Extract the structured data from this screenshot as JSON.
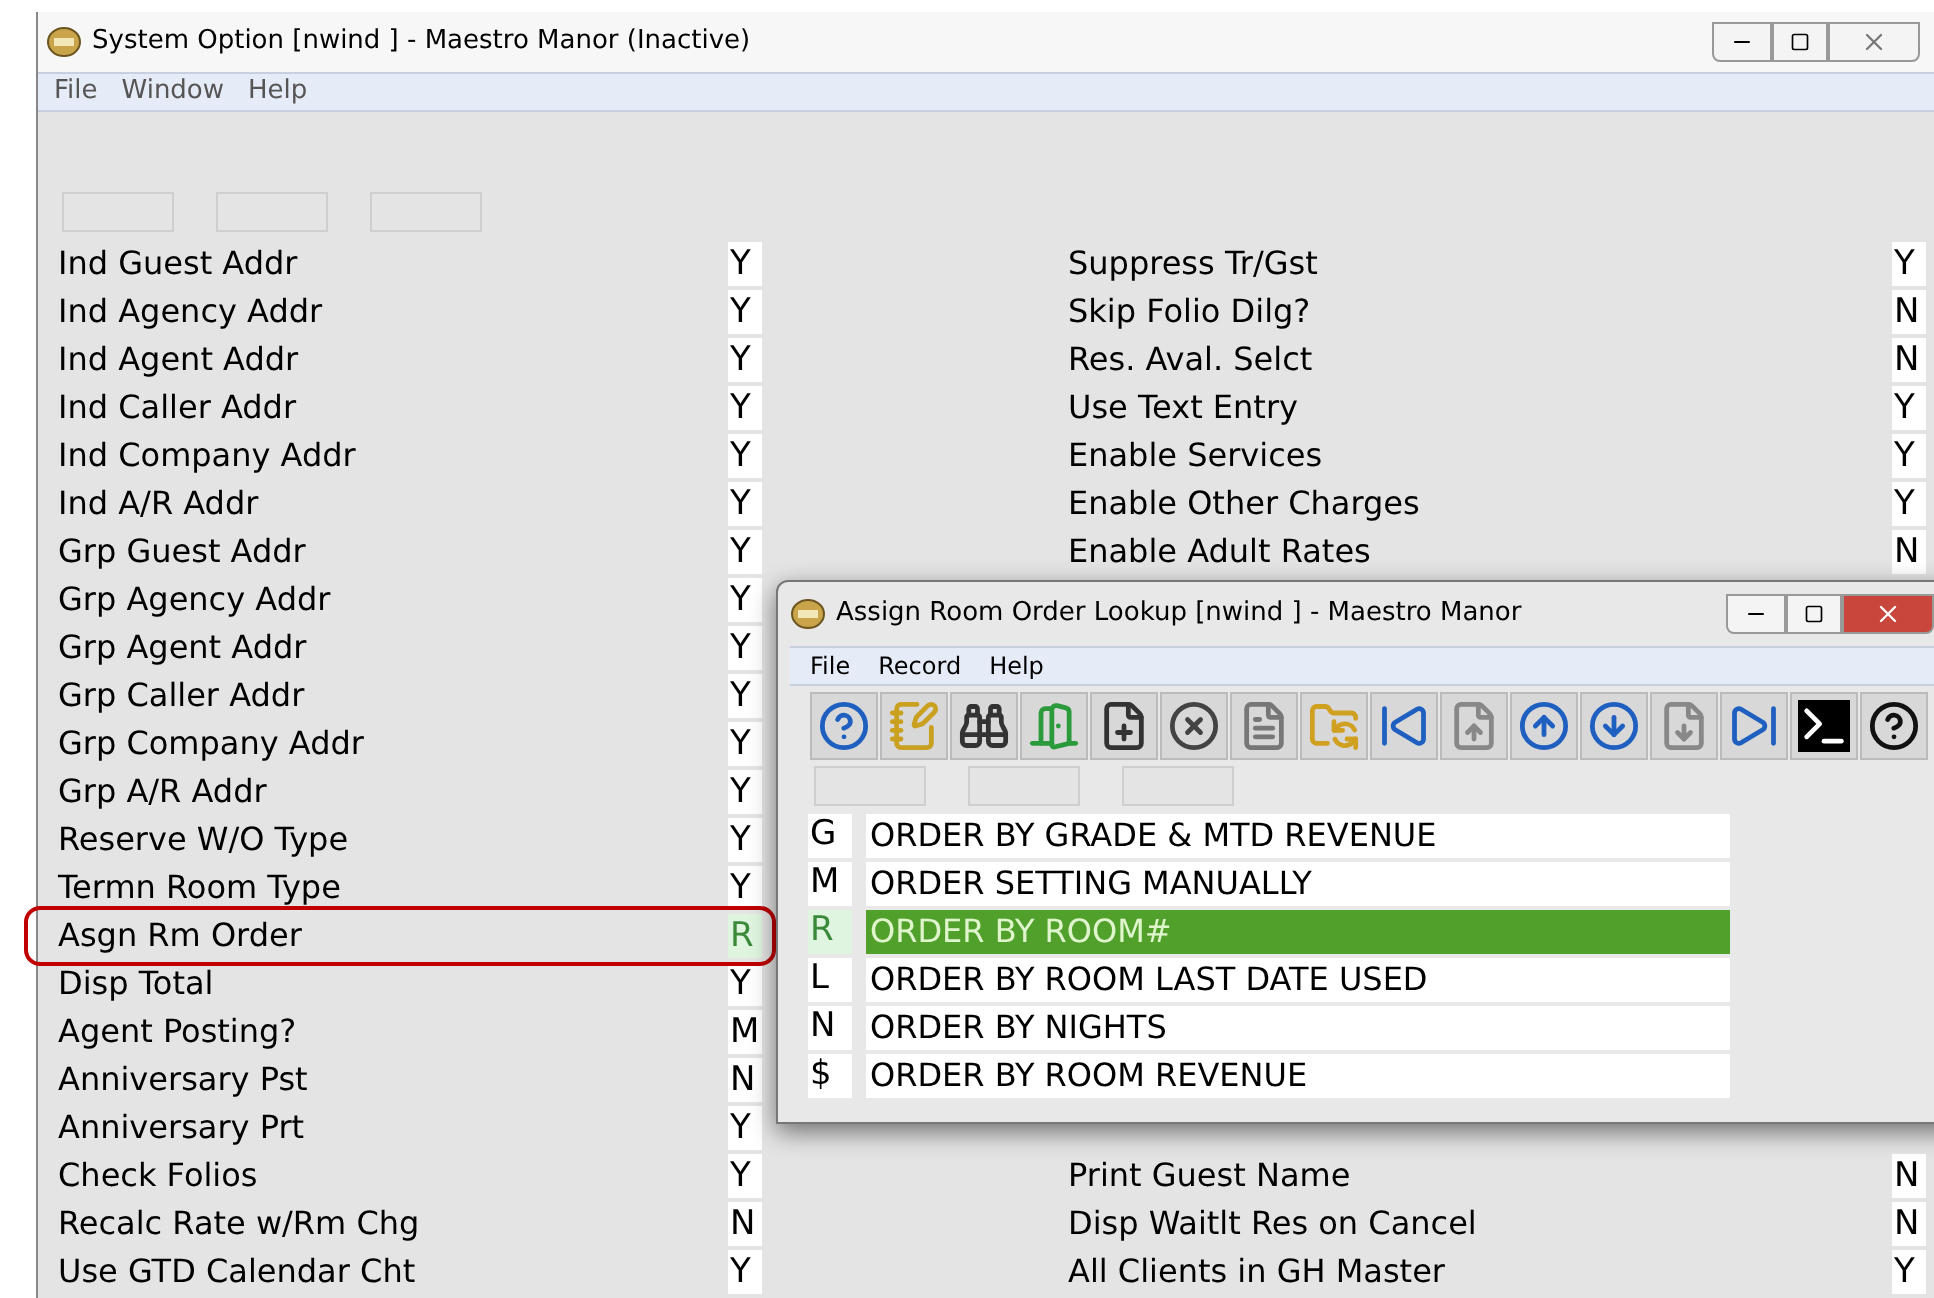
{
  "window": {
    "title": "System Option [nwind   ] - Maestro Manor (Inactive)"
  },
  "menu": [
    "File",
    "Window",
    "Help"
  ],
  "left_column": [
    {
      "label": "Ind Guest Addr",
      "value": "Y",
      "focused": false
    },
    {
      "label": "Ind Agency Addr",
      "value": "Y",
      "focused": false
    },
    {
      "label": "Ind Agent Addr",
      "value": "Y",
      "focused": false
    },
    {
      "label": "Ind Caller Addr",
      "value": "Y",
      "focused": false
    },
    {
      "label": "Ind Company Addr",
      "value": "Y",
      "focused": false
    },
    {
      "label": "Ind A/R Addr",
      "value": "Y",
      "focused": false
    },
    {
      "label": "Grp Guest Addr",
      "value": "Y",
      "focused": false
    },
    {
      "label": "Grp Agency Addr",
      "value": "Y",
      "focused": false
    },
    {
      "label": "Grp Agent Addr",
      "value": "Y",
      "focused": false
    },
    {
      "label": "Grp Caller Addr",
      "value": "Y",
      "focused": false
    },
    {
      "label": "Grp Company Addr",
      "value": "Y",
      "focused": false
    },
    {
      "label": "Grp A/R Addr",
      "value": "Y",
      "focused": false
    },
    {
      "label": "Reserve W/O Type",
      "value": "Y",
      "focused": false
    },
    {
      "label": "Termn Room Type",
      "value": "Y",
      "focused": false
    },
    {
      "label": "Asgn Rm Order",
      "value": "R",
      "focused": true
    },
    {
      "label": "Disp Total",
      "value": "Y",
      "focused": false
    },
    {
      "label": "Agent Posting?",
      "value": "M",
      "focused": false
    },
    {
      "label": "Anniversary Pst",
      "value": "N",
      "focused": false
    },
    {
      "label": "Anniversary Prt",
      "value": "Y",
      "focused": false
    },
    {
      "label": "Check Folios",
      "value": "Y",
      "focused": false
    },
    {
      "label": "Recalc Rate w/Rm Chg",
      "value": "N",
      "focused": false
    },
    {
      "label": "Use GTD Calendar Cht",
      "value": "Y",
      "focused": false
    }
  ],
  "right_column_top": [
    {
      "label": "Suppress Tr/Gst",
      "value": "Y"
    },
    {
      "label": "Skip Folio Dilg?",
      "value": "N"
    },
    {
      "label": "Res. Aval. Selct",
      "value": "N"
    },
    {
      "label": "Use Text Entry",
      "value": "Y"
    },
    {
      "label": "Enable Services",
      "value": "Y"
    },
    {
      "label": "Enable Other Charges",
      "value": "Y"
    },
    {
      "label": "Enable Adult Rates",
      "value": "N"
    }
  ],
  "right_column_bottom": [
    {
      "label": "Print Guest Name",
      "value": "N"
    },
    {
      "label": "Disp Waitlt Res on Cancel",
      "value": "N"
    },
    {
      "label": "All Clients in GH Master",
      "value": "Y"
    }
  ],
  "dialog": {
    "title": "Assign Room Order Lookup [nwind   ] - Maestro Manor",
    "menu": [
      "File",
      "Record",
      "Help"
    ],
    "rows": [
      {
        "code": "G",
        "description": "ORDER BY GRADE & MTD REVENUE",
        "selected": false
      },
      {
        "code": "M",
        "description": "ORDER SETTING MANUALLY",
        "selected": false
      },
      {
        "code": "R",
        "description": "ORDER BY ROOM#",
        "selected": true
      },
      {
        "code": "L",
        "description": "ORDER BY ROOM LAST DATE USED",
        "selected": false
      },
      {
        "code": "N",
        "description": "ORDER BY NIGHTS",
        "selected": false
      },
      {
        "code": "$",
        "description": "ORDER BY ROOM REVENUE",
        "selected": false
      }
    ]
  }
}
